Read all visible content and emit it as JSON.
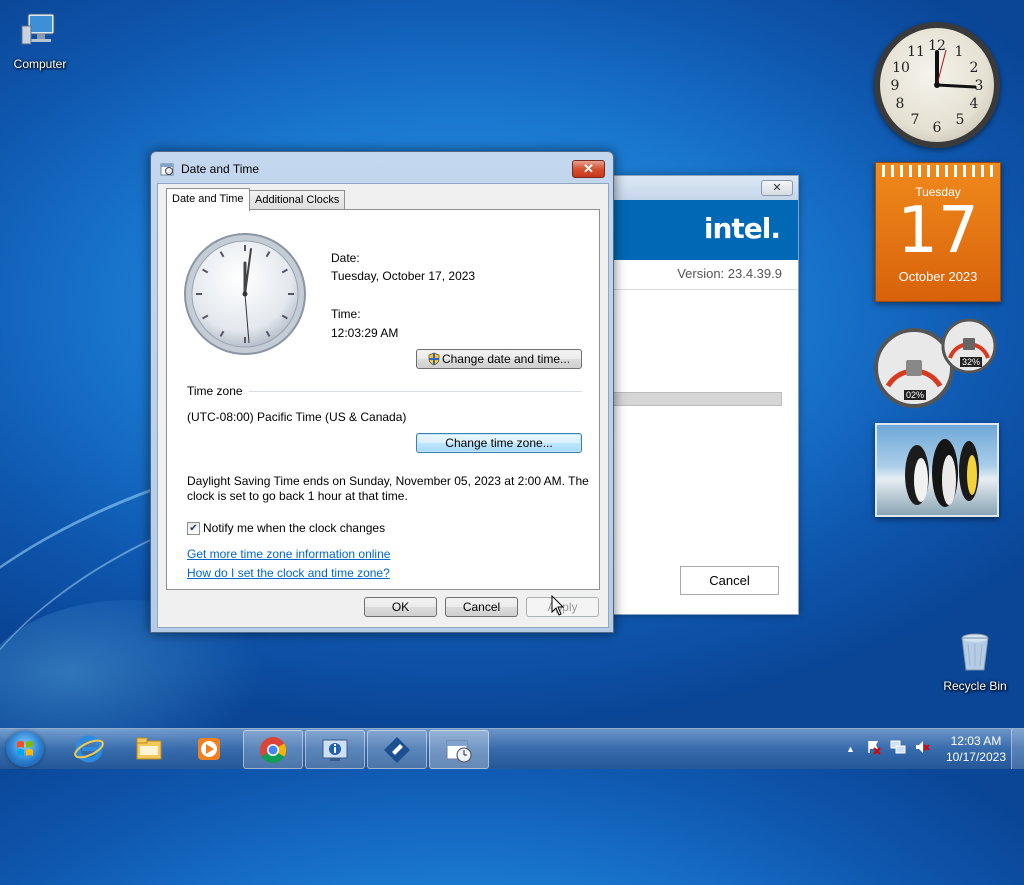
{
  "desktop": {
    "icons": [
      {
        "label": "Computer"
      },
      {
        "label": "Recycle Bin"
      }
    ]
  },
  "gadgets": {
    "calendar": {
      "weekday": "Tuesday",
      "day": "17",
      "month_year": "October 2023"
    },
    "cpu_meter": {
      "cpu": "02%",
      "memory": "32%"
    }
  },
  "intel_window": {
    "logo": "intel.",
    "version": "Version: 23.4.39.9",
    "close_label": "✕",
    "cancel_label": "Cancel"
  },
  "dialog": {
    "title": "Date and Time",
    "close_label": "✕",
    "tabs": [
      {
        "label": "Date and Time",
        "active": true
      },
      {
        "label": "Additional Clocks",
        "active": false
      }
    ],
    "date_label": "Date:",
    "date_value": "Tuesday, October 17, 2023",
    "time_label": "Time:",
    "time_value": "12:03:29 AM",
    "change_datetime_label": "Change date and time...",
    "timezone_heading": "Time zone",
    "timezone_value": "(UTC-08:00) Pacific Time (US & Canada)",
    "change_timezone_label": "Change time zone...",
    "dst_line1": "Daylight Saving Time ends on Sunday, November 05, 2023 at 2:00 AM. The",
    "dst_line2": "clock is set to go back 1 hour at that time.",
    "notify_label": "Notify me when the clock changes",
    "notify_checked": true,
    "link_more_info": "Get more time zone information online",
    "link_how_to": "How do I set the clock and time zone?",
    "ok_label": "OK",
    "cancel_label": "Cancel",
    "apply_label": "Apply"
  },
  "taskbar": {
    "clock_time": "12:03 AM",
    "clock_date": "10/17/2023",
    "show_hidden_label": "▲",
    "pinned": [
      {
        "name": "internet-explorer"
      },
      {
        "name": "windows-explorer"
      },
      {
        "name": "media-player"
      },
      {
        "name": "chrome"
      },
      {
        "name": "intel-driver-assistant"
      },
      {
        "name": "intel-graphics"
      },
      {
        "name": "date-and-time"
      }
    ]
  },
  "colors": {
    "accent_blue": "#0068b5",
    "calendar_orange": "#e8731a",
    "link": "#0066cc"
  }
}
